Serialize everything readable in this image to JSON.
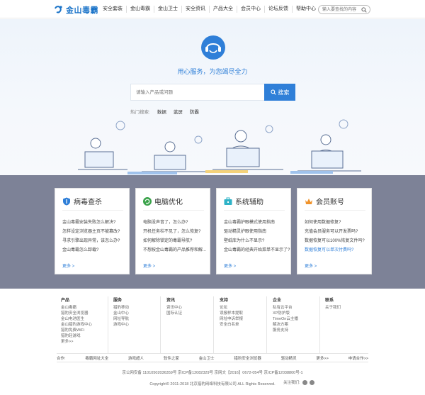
{
  "brand": {
    "name": "金山毒霸",
    "color": "#1a73c8"
  },
  "nav": [
    "安全套装",
    "金山毒霸",
    "金山卫士",
    "安全资讯",
    "产品大全",
    "会员中心",
    "论坛反馈",
    "帮助中心"
  ],
  "header_search": {
    "placeholder": "输入要查找的内容"
  },
  "hero": {
    "slogan": "用心服务，为您竭尽全力",
    "search_placeholder": "请输入产品或问题",
    "search_button": "搜索",
    "hot_label": "热门搜索:",
    "hot_keywords": [
      "数据",
      "蓝屏",
      "防霸"
    ]
  },
  "cards": [
    {
      "title": "病毒查杀",
      "icon": "shield-icon",
      "items": [
        "金山毒霸安装失败怎么解决?",
        "怎样设定浏览器主页不被篡改?",
        "寻求引擎出现异常，该怎么办?",
        "金山毒霸怎么卸载?"
      ],
      "more": "更多 >"
    },
    {
      "title": "电脑优化",
      "icon": "refresh-icon",
      "items": [
        "电脑没声音了，怎么办?",
        "开机任务栏不见了，怎么恢复?",
        "如何解除锁定的毒霸导航?",
        "不想按金山毒霸的产品推荐和解..."
      ],
      "more": "更多 >"
    },
    {
      "title": "系统辅助",
      "icon": "toolbox-icon",
      "items": [
        "金山毒霸护眼模式使用指南",
        "驱动精灵护眼使用指南",
        "壁纸库为什么不显示?",
        "金山毒霸的经典开始菜单不显示了?"
      ],
      "more": "更多 >"
    },
    {
      "title": "会员账号",
      "icon": "crown-icon",
      "items": [
        "如何使用数据修复?",
        "充值会员服务可以开发票吗?",
        "数据恢复可以100%恢复文件吗?",
        "数据恢复可以单次付费吗?"
      ],
      "more": "更多 >",
      "highlight_last": true
    }
  ],
  "footer": {
    "columns": [
      {
        "title": "产品",
        "links": [
          "金山毒霸",
          "猎豹安全浏览器",
          "金山电池医生",
          "金山猎豹游戏中心",
          "猎豹免费WiFi",
          "猎豹轻游戏",
          "更多>>"
        ]
      },
      {
        "title": "服务",
        "links": [
          "猎豹移动",
          "金山中心",
          "网址导航",
          "游戏中心"
        ]
      },
      {
        "title": "资讯",
        "links": [
          "资讯中心",
          "国际认证"
        ]
      },
      {
        "title": "支持",
        "links": [
          "论坛",
          "误报样本提取",
          "网址申诉举报",
          "安全白名单"
        ]
      },
      {
        "title": "企业",
        "links": [
          "私有云平台",
          "XP防护版",
          "TimeOn云主播",
          "解决方案",
          "服务支持"
        ]
      },
      {
        "title": "联系",
        "links": [
          "关于我们"
        ]
      }
    ],
    "partners_label": "合作:",
    "partners": [
      "毒霸网址大全",
      "游戏超人",
      "软件之家",
      "金山卫士",
      "猎豹安全浏览器",
      "驱动精灵",
      "更多>>",
      "申请合作>>"
    ],
    "license": "京公网安备 11010502036359号   京ICP备12082329号   京网文【2016】0672-054号   京ICP备12038800号-1",
    "copyright": "Copyright© 2011-2018 北京猎豹网络科技有限公司 ALL Rights Reserved.",
    "follow": "关注我们:"
  }
}
